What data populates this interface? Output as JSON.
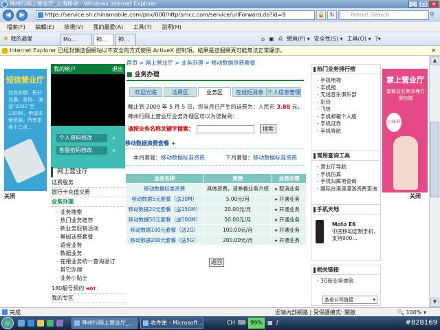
{
  "window": {
    "title": "神州行网上营业厅_上海移动 - Windows Internet Explorer",
    "min": "_",
    "max": "□",
    "close": "✕"
  },
  "address": {
    "url": "https://service.sh.chinamobile.com/pnx/000/http/smcc.com/service/urlForward.do?id=9",
    "search_placeholder": "Yahoo! Search"
  },
  "menu": [
    "檔案(F)",
    "編輯(E)",
    "檢視(V)",
    "我的最愛(A)",
    "工具(T)",
    "說明(H)"
  ],
  "toolbar": {
    "favorites": "我的最愛",
    "tabs": [
      "Mo...",
      "神...",
      "神..."
    ],
    "commands": [
      "網頁(P) ▾",
      "安全性(S) ▾",
      "工具(O) ▾",
      "?▾"
    ]
  },
  "infobar": {
    "text": "Internet Explorer 已經封鎖這個網站以不安全的方式使用 ActiveX 控制項。結果是這個網頁可能無法正常顯示。",
    "close": "✕"
  },
  "page": {
    "breadcrumb": "首页 > 网上营业厅 > 业务办理 > 移动数据资费套餐",
    "section_title": "业务办理",
    "left_ad": {
      "title": "短信营业厅",
      "text": "业务办理、积分兑换、查询... 发送\"2001\"至10086，申请本地资源。所有本地十二点...",
      "close": "关闭"
    },
    "left_nav": {
      "my_account": "我的帐户",
      "logout": "退出",
      "btn_profile": "个人资料修改",
      "btn_password": "客服密码修改",
      "online_hall": "网上营业厅",
      "items": [
        {
          "label": "话费服务",
          "hl": false
        },
        {
          "label": "银行卡充值交费",
          "hl": false
        },
        {
          "label": "业务办理",
          "hl": true
        }
      ],
      "subitems": [
        "业务搜索",
        "热门业务推荐",
        "新业务促销活动",
        "基础话费套餐",
        "语音业务",
        "数据业务",
        "在用业务统一查询退订",
        "其它办理",
        "业务小贴士"
      ],
      "item_180": "180靓号预约",
      "hot": "HOT",
      "item_zone": "我的专区"
    },
    "tabs": [
      "欢迎光临",
      "话费区",
      "业务区",
      "在线短消息",
      "个人信息管理"
    ],
    "notice_line1_a": "截止到 2009 年 5 月 5 日，您当月已产生的话费为：",
    "notice_line1_b": "人民币 ",
    "notice_amount": "3.88",
    "notice_line1_c": " 元。",
    "notice_line2": "神州行网上营业厅业务办理区可以为您做到：",
    "keyword_label": "请按业务名称关键字搜索：",
    "search_btn": "搜索",
    "package_title": "移动数据资费套餐",
    "package_plus": "+",
    "this_month_label": "本月套餐：",
    "this_month_value": "移动数据标准资费",
    "next_month_label": "下月套餐：",
    "next_month_value": "移动数据标准资费",
    "table": {
      "headers": [
        "业务名称",
        "资费",
        "业务办理"
      ],
      "rows": [
        {
          "name": "移动数据标准资费",
          "fee": "具体资费，请参看业务介绍",
          "op": "取消业务"
        },
        {
          "name": "移动数据5元套餐（送30M）",
          "fee": "5.00元/月",
          "op": "开通业务"
        },
        {
          "name": "移动数据20元套餐（送150M）",
          "fee": "20.00元/月",
          "op": "开通业务"
        },
        {
          "name": "移动数据50元套餐（送500M）",
          "fee": "50.00元/月",
          "op": "开通业务"
        },
        {
          "name": "移动数据100元套餐（送2G）",
          "fee": "100.00元/月",
          "op": "开通业务"
        },
        {
          "name": "移动数据200元套餐（送5G）",
          "fee": "200.00元/月",
          "op": "开通业务"
        }
      ]
    },
    "back_btn": "返回",
    "right": {
      "hot_title": "热门业务排行榜",
      "hot_items": [
        "手机电视",
        "手机报",
        "无线音乐俱乐部",
        "彩铃",
        "飞信",
        "手机邮箱个人版",
        "手机证券",
        "手机导航"
      ],
      "tools_title": "常用查询工具",
      "tools_items": [
        "营业厅导航",
        "手机仿真",
        "手机归属地查询",
        "国际台港澳漫游资费查询"
      ],
      "phone_title": "手机天地",
      "phone_model": "Moto E6",
      "phone_desc": "中国移动定制手机，支持900...",
      "links_title": "相关链接",
      "links_item": "3G新业务体验",
      "links_select": "各省公司链接"
    },
    "right_ad": {
      "title": "掌上营业厅",
      "text": "套餐及业务办理方便快捷",
      "tag": "小秘书",
      "close": "关闭"
    }
  },
  "status": {
    "done": "完成",
    "zone": "近端內部網路 | 受保護模式: 開啟",
    "zoom": "🔍 100% ▾"
  },
  "taskbar": {
    "tasks": [
      "神州行网上营业厅_...",
      "收件匣 - Microsoft ..."
    ],
    "lang": "CH",
    "battery": "99%",
    "id": "#828169"
  }
}
